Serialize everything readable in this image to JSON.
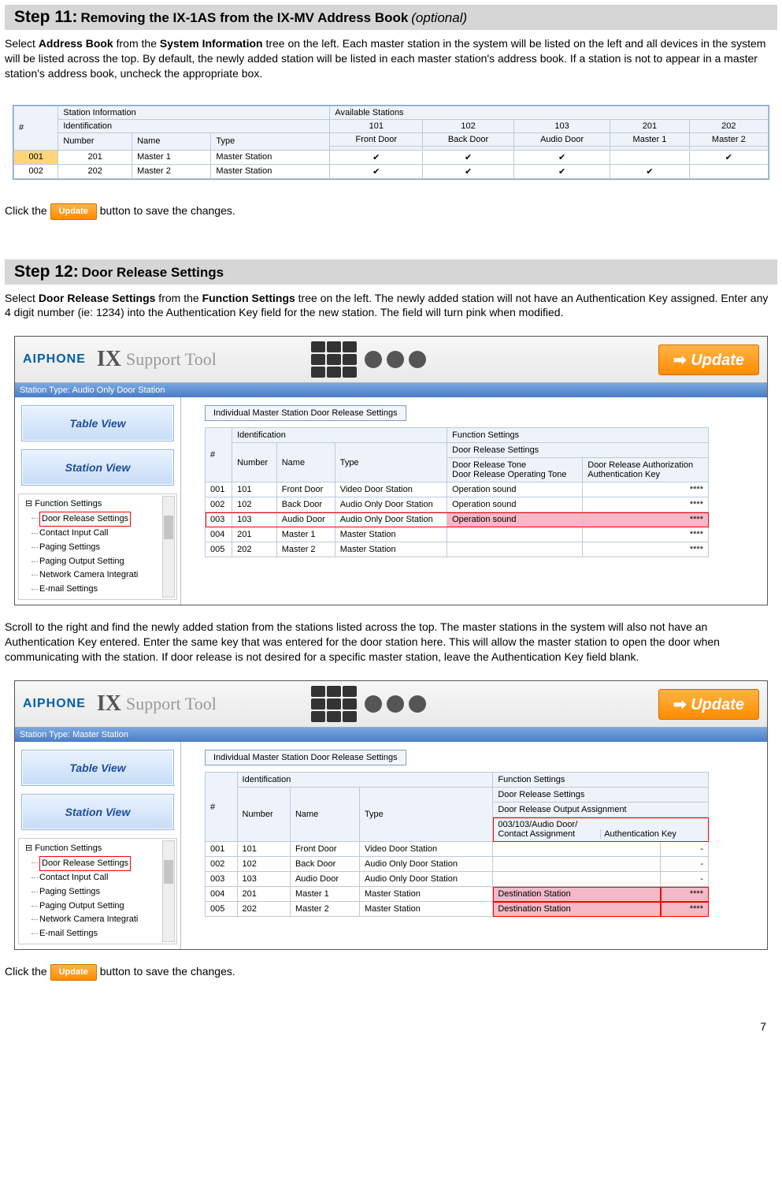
{
  "step11": {
    "num": "Step 11:",
    "title": "Removing the IX-1AS from the IX-MV Address Book",
    "opt": "(optional)",
    "p1a": "Select ",
    "p1b": "Address Book",
    "p1c": " from the ",
    "p1d": "System Information",
    "p1e": " tree on the left. Each master station in the system will be listed on the left and all devices in the system will be listed across the top. By default, the newly added station will be listed in each master station's address book. If a station is not to appear in a master station's address book, uncheck the appropriate box."
  },
  "table1": {
    "h_hash": "#",
    "h_si": "Station Information",
    "h_as": "Available Stations",
    "h_id": "Identification",
    "h_num": "Number",
    "h_name": "Name",
    "h_type": "Type",
    "cols": {
      "c101": "101",
      "c102": "102",
      "c103": "103",
      "c201": "201",
      "c202": "202"
    },
    "names": {
      "n101": "Front Door",
      "n102": "Back Door",
      "n103": "Audio Door",
      "n201": "Master 1",
      "n202": "Master 2"
    },
    "r1": {
      "idx": "001",
      "num": "201",
      "name": "Master 1",
      "type": "Master Station",
      "v": [
        "✔",
        "✔",
        "✔",
        "",
        "✔"
      ]
    },
    "r2": {
      "idx": "002",
      "num": "202",
      "name": "Master 2",
      "type": "Master Station",
      "v": [
        "✔",
        "✔",
        "✔",
        "✔",
        ""
      ]
    }
  },
  "click_update": "Click the",
  "click_update_after": "button to save the changes.",
  "update_label": "Update",
  "step12": {
    "num": "Step 12:",
    "title": "Door Release Settings",
    "p1a": "Select ",
    "p1b": "Door Release Settings",
    "p1c": " from the ",
    "p1d": "Function Settings",
    "p1e": " tree on the left. The newly added station will not have an Authentication Key assigned. Enter any 4 digit number (ie: 1234) into the Authentication Key field for the new station. The field will turn pink when modified.",
    "p2": "Scroll to the right and find the newly added station from the stations listed across the top. The master stations in the system will also not have an Authentication Key entered. Enter the same key that was entered for the door station here. This will allow the master station to open the door when communicating with the station. If door release is not desired for a specific master station, leave the Authentication Key field blank."
  },
  "shot": {
    "aiphone": "AIPHONE",
    "ix": "IX",
    "support": "Support Tool",
    "update": "Update",
    "st_audio": "Station Type:  Audio Only Door Station",
    "st_master": "Station Type:  Master Station",
    "table_view": "Table View",
    "station_view": "Station View",
    "section": "Individual Master Station Door Release Settings",
    "tree_root": "Function Settings",
    "tree": {
      "drs": "Door Release Settings",
      "cic": "Contact Input Call",
      "ps": "Paging Settings",
      "pos": "Paging Output Setting",
      "nci": "Network Camera Integrati",
      "es": "E-mail Settings"
    }
  },
  "tbl2a": {
    "hash": "#",
    "id": "Identification",
    "num": "Number",
    "name": "Name",
    "type": "Type",
    "fs": "Function Settings",
    "drs": "Door Release Settings",
    "drt": "Door Release Tone",
    "dra": "Door Release Authorization",
    "drot": "Door Release Operating Tone",
    "ak": "Authentication Key",
    "rows": [
      {
        "i": "001",
        "n": "101",
        "nm": "Front Door",
        "t": "Video Door Station",
        "tone": "Operation sound",
        "k": "****"
      },
      {
        "i": "002",
        "n": "102",
        "nm": "Back Door",
        "t": "Audio Only Door Station",
        "tone": "Operation sound",
        "k": "****"
      },
      {
        "i": "003",
        "n": "103",
        "nm": "Audio Door",
        "t": "Audio Only Door Station",
        "tone": "Operation sound",
        "k": "****"
      },
      {
        "i": "004",
        "n": "201",
        "nm": "Master 1",
        "t": "Master Station",
        "tone": "",
        "k": "****"
      },
      {
        "i": "005",
        "n": "202",
        "nm": "Master 2",
        "t": "Master Station",
        "tone": "",
        "k": "****"
      }
    ]
  },
  "tbl2b": {
    "droa": "Door Release Output Assignment",
    "path": "003/103/Audio Door/",
    "ca": "Contact Assignment",
    "ak": "Authentication Key",
    "rows": [
      {
        "i": "001",
        "n": "101",
        "nm": "Front Door",
        "t": "Video Door Station",
        "ca": "",
        "k": "-"
      },
      {
        "i": "002",
        "n": "102",
        "nm": "Back Door",
        "t": "Audio Only Door Station",
        "ca": "",
        "k": "-"
      },
      {
        "i": "003",
        "n": "103",
        "nm": "Audio Door",
        "t": "Audio Only Door Station",
        "ca": "",
        "k": "-"
      },
      {
        "i": "004",
        "n": "201",
        "nm": "Master 1",
        "t": "Master Station",
        "ca": "Destination Station",
        "k": "****"
      },
      {
        "i": "005",
        "n": "202",
        "nm": "Master 2",
        "t": "Master Station",
        "ca": "Destination Station",
        "k": "****"
      }
    ]
  },
  "page": "7"
}
